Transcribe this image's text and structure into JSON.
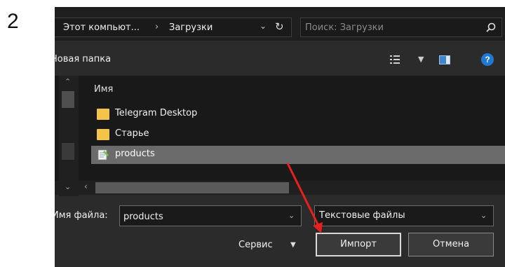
{
  "step_number": "2",
  "address": {
    "crumb1": "Этот компьют...",
    "separator": "›",
    "crumb2": "Загрузки"
  },
  "search": {
    "placeholder": "Поиск: Загрузки"
  },
  "toolbar": {
    "new_folder": "Новая папка",
    "help": "?"
  },
  "list": {
    "column_name": "Имя",
    "files": [
      {
        "name": "Telegram Desktop",
        "type": "folder",
        "icon": "folder-icon"
      },
      {
        "name": "Старье",
        "type": "folder",
        "icon": "folder-icon"
      },
      {
        "name": "products",
        "type": "text-file",
        "icon": "text-file-icon",
        "selected": true
      }
    ]
  },
  "bottom": {
    "filename_label": "Имя файла:",
    "filename_value": "products",
    "filetype": "Текстовые файлы",
    "service_label": "Сервис",
    "import_label": "Импорт",
    "cancel_label": "Отмена"
  },
  "colors": {
    "annotation_arrow": "#e8211f",
    "folder": "#f3c34a",
    "selection": "#6b6b6b"
  }
}
